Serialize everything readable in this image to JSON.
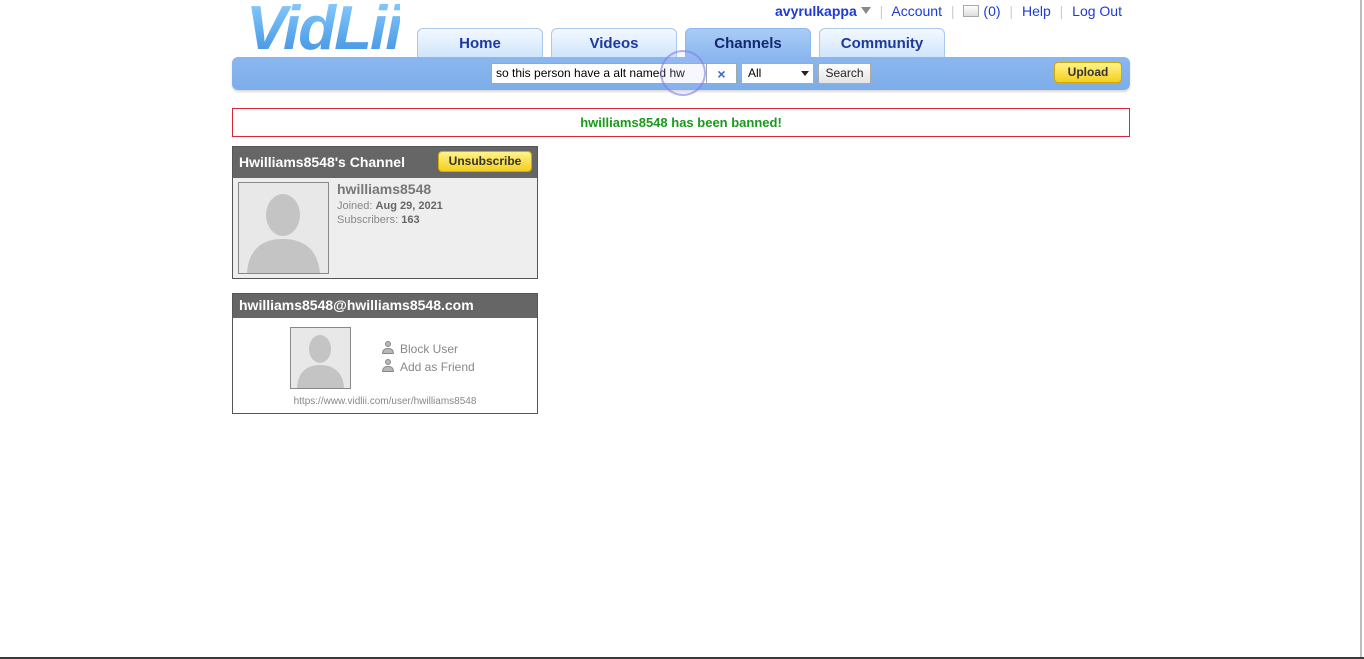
{
  "logo": {
    "text": "VidLii"
  },
  "topnav": {
    "username": "avyrulkappa",
    "account": "Account",
    "inbox_count": "(0)",
    "help": "Help",
    "logout": "Log Out"
  },
  "tabs": [
    {
      "label": "Home",
      "active": false
    },
    {
      "label": "Videos",
      "active": false
    },
    {
      "label": "Channels",
      "active": true
    },
    {
      "label": "Community",
      "active": false
    }
  ],
  "search": {
    "value": "so this person have a alt named hw",
    "clear_label": "×",
    "category": "All",
    "button_label": "Search"
  },
  "upload_label": "Upload",
  "alert": {
    "message": "hwilliams8548 has been banned!"
  },
  "channel": {
    "title": "Hwilliams8548's Channel",
    "unsubscribe_label": "Unsubscribe",
    "username": "hwilliams8548",
    "joined_label": "Joined:",
    "joined_value": "Aug 29, 2021",
    "subscribers_label": "Subscribers:",
    "subscribers_value": "163"
  },
  "profile": {
    "title": "hwilliams8548@hwilliams8548.com",
    "block_user": "Block User",
    "add_friend": "Add as Friend",
    "url": "https://www.vidlii.com/user/hwilliams8548"
  },
  "colors": {
    "accent_blue": "#8ab7ef",
    "link_blue": "#1d3ad8",
    "success_green": "#1a9a1a",
    "alert_border": "#d9263a",
    "button_yellow": "#f5cf1f"
  }
}
